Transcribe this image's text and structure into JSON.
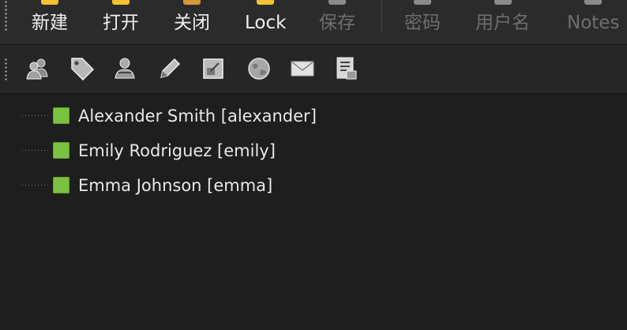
{
  "toolbar": {
    "buttons": [
      {
        "label": "新建",
        "enabled": true,
        "icon": "new-entry-icon",
        "icon_color": "#f1c232"
      },
      {
        "label": "打开",
        "enabled": true,
        "icon": "open-icon",
        "icon_color": "#f1c232"
      },
      {
        "label": "关闭",
        "enabled": true,
        "icon": "close-icon",
        "icon_color": "#d29a3b"
      },
      {
        "label": "Lock",
        "enabled": true,
        "icon": "lock-icon",
        "icon_color": "#f1c232"
      },
      {
        "label": "保存",
        "enabled": false,
        "icon": "save-icon",
        "icon_color": "#8a8a8a"
      },
      {
        "label": "密码",
        "enabled": false,
        "icon": "copy-password-icon",
        "icon_color": "#8a8a8a"
      },
      {
        "label": "用户名",
        "enabled": false,
        "icon": "copy-username-icon",
        "icon_color": "#8a8a8a"
      },
      {
        "label": "Notes",
        "enabled": false,
        "icon": "notes-icon",
        "icon_color": "#8a8a8a"
      }
    ]
  },
  "icon_toolbar": {
    "icons": [
      "users-icon",
      "tag-icon",
      "user-edit-icon",
      "pencil-icon",
      "window-resize-icon",
      "globe-icon",
      "mail-icon",
      "checklist-icon"
    ]
  },
  "tree": {
    "items": [
      {
        "label": "Alexander Smith [alexander]",
        "icon": "green-square-icon"
      },
      {
        "label": "Emily Rodriguez [emily]",
        "icon": "green-square-icon"
      },
      {
        "label": "Emma Johnson [emma]",
        "icon": "green-square-icon"
      }
    ]
  },
  "colors": {
    "toolbar_bg": "#2b2b2b",
    "icon_toolbar_bg": "#262626",
    "tree_bg": "#1e1e1e",
    "node_green": "#7cc242",
    "enabled_text": "#f0f0f0",
    "disabled_text": "#6e6e6e"
  }
}
